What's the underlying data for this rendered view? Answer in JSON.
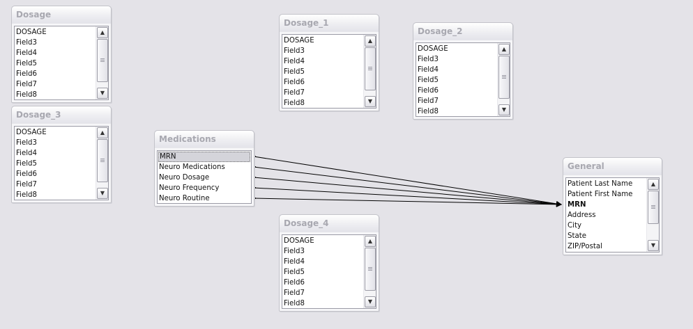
{
  "tables": [
    {
      "id": "dosage",
      "title": "Dosage",
      "fields": [
        "DOSAGE",
        "Field3",
        "Field4",
        "Field5",
        "Field6",
        "Field7",
        "Field8"
      ]
    },
    {
      "id": "dosage3",
      "title": "Dosage_3",
      "fields": [
        "DOSAGE",
        "Field3",
        "Field4",
        "Field5",
        "Field6",
        "Field7",
        "Field8"
      ]
    },
    {
      "id": "dosage1",
      "title": "Dosage_1",
      "fields": [
        "DOSAGE",
        "Field3",
        "Field4",
        "Field5",
        "Field6",
        "Field7",
        "Field8"
      ]
    },
    {
      "id": "dosage2",
      "title": "Dosage_2",
      "fields": [
        "DOSAGE",
        "Field3",
        "Field4",
        "Field5",
        "Field6",
        "Field7",
        "Field8"
      ]
    },
    {
      "id": "medications",
      "title": "Medications",
      "fields": [
        "MRN",
        "Neuro Medications",
        "Neuro Dosage",
        "Neuro Frequency",
        "Neuro Routine"
      ],
      "selected_field": "MRN"
    },
    {
      "id": "dosage4",
      "title": "Dosage_4",
      "fields": [
        "DOSAGE",
        "Field3",
        "Field4",
        "Field5",
        "Field6",
        "Field7",
        "Field8"
      ]
    },
    {
      "id": "general",
      "title": "General",
      "fields": [
        "Patient Last Name",
        "Patient First Name",
        "MRN",
        "Address",
        "City",
        "State",
        "ZIP/Postal"
      ],
      "bold_field": "MRN"
    }
  ],
  "relationships": [
    {
      "from_table": "Medications",
      "from_field": "MRN",
      "to_table": "General",
      "to_field": "MRN"
    },
    {
      "from_table": "Medications",
      "from_field": "Neuro Medications",
      "to_table": "General",
      "to_field": "MRN"
    },
    {
      "from_table": "Medications",
      "from_field": "Neuro Dosage",
      "to_table": "General",
      "to_field": "MRN"
    },
    {
      "from_table": "Medications",
      "from_field": "Neuro Frequency",
      "to_table": "General",
      "to_field": "MRN"
    },
    {
      "from_table": "Medications",
      "from_field": "Neuro Routine",
      "to_table": "General",
      "to_field": "MRN"
    }
  ],
  "colors": {
    "background": "#e4e3e8",
    "title_text": "#a8a8b0",
    "selected_field": "#d4d4da"
  }
}
